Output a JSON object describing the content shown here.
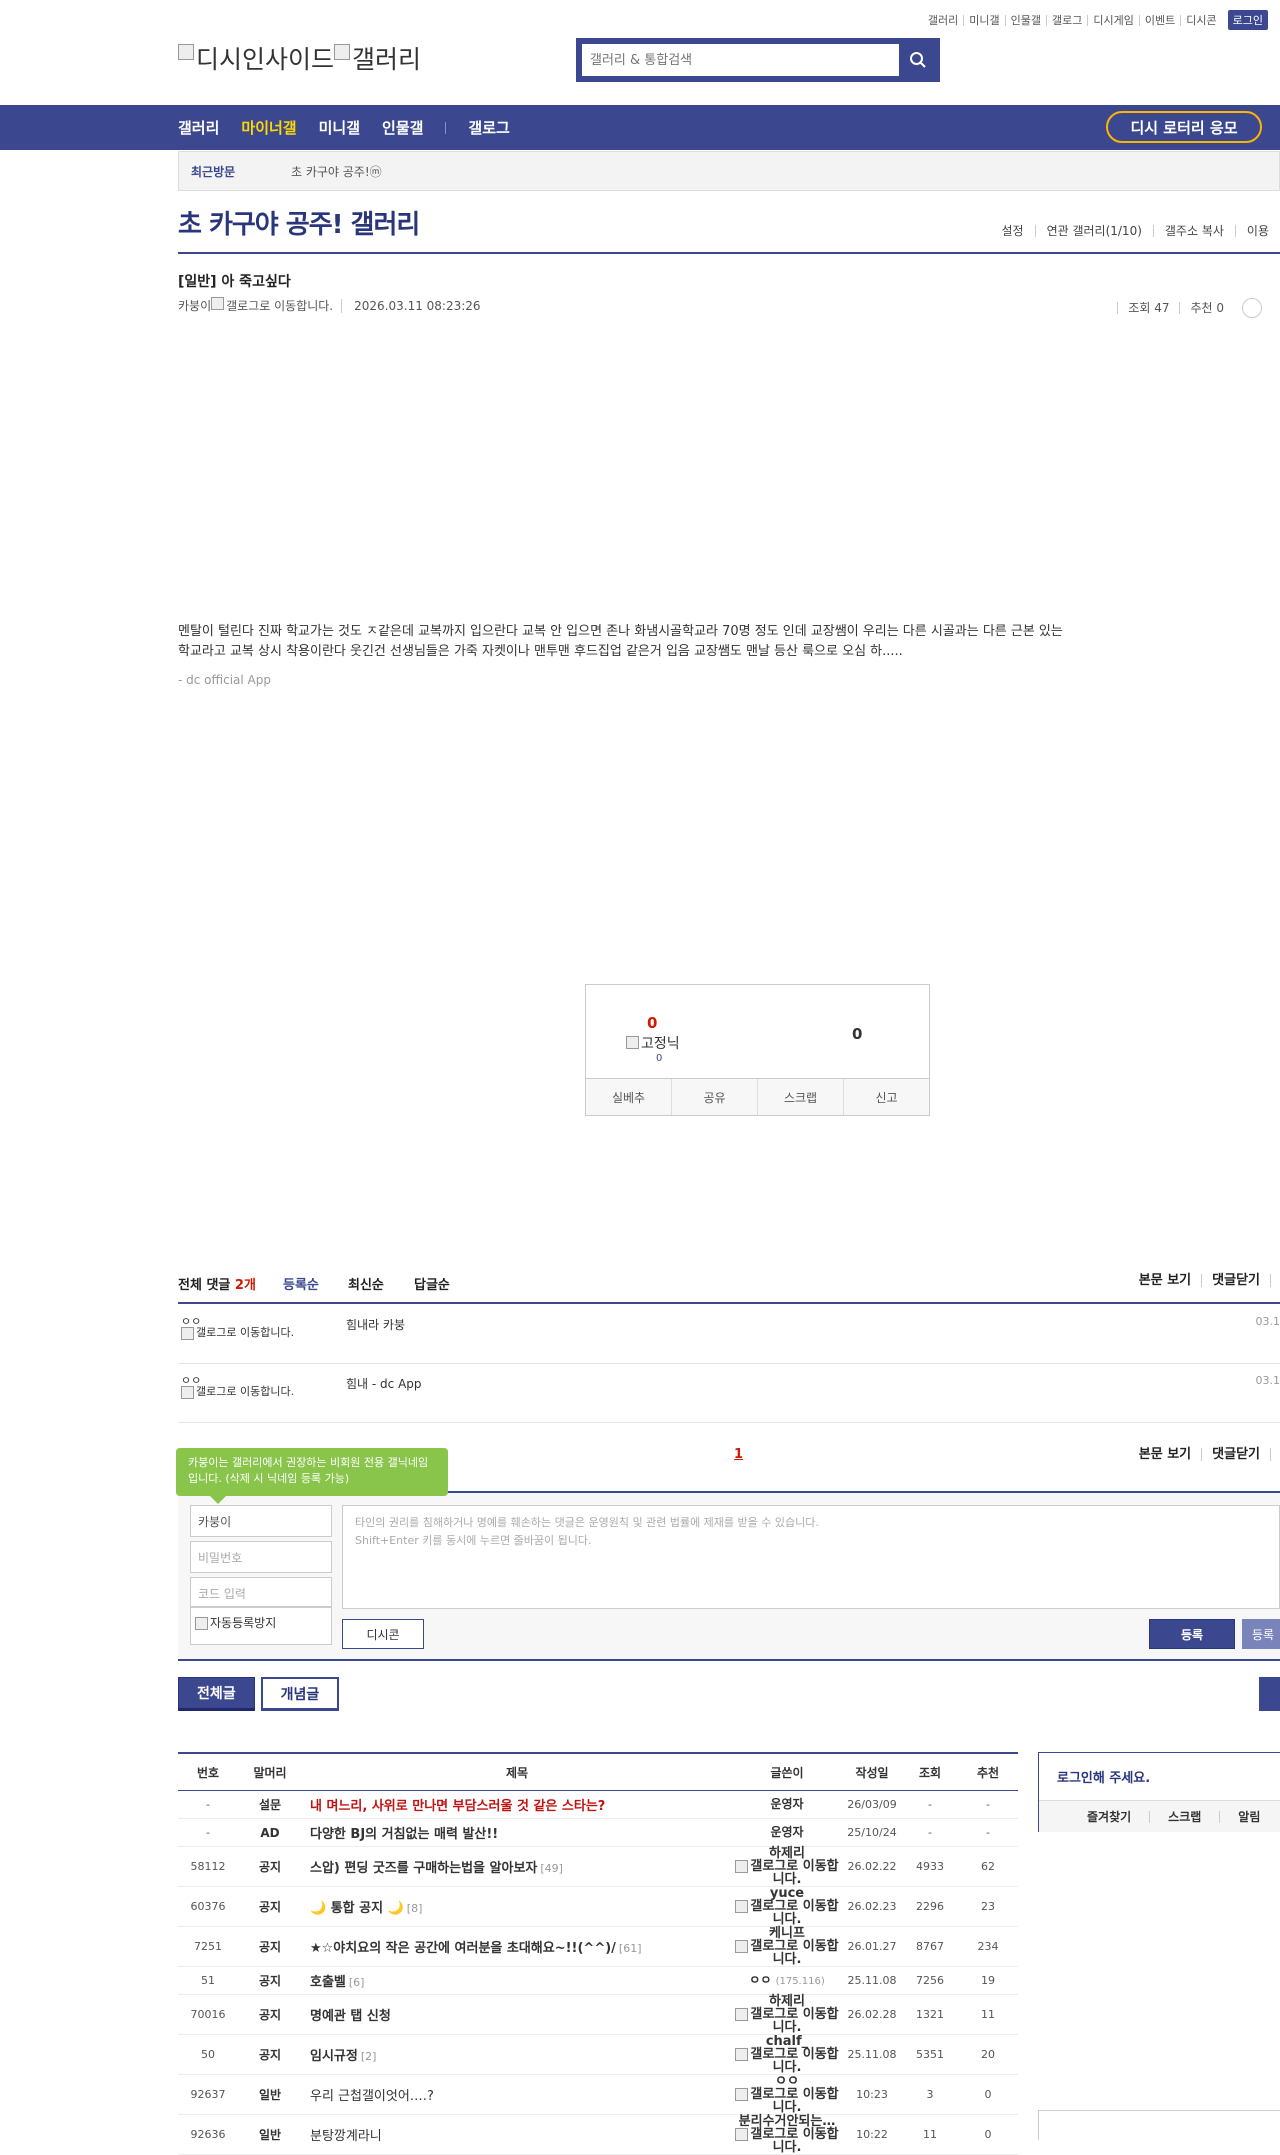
{
  "top_links": [
    "갤러리",
    "미니갤",
    "인물갤",
    "갤로그",
    "디시게임",
    "이벤트",
    "디시콘"
  ],
  "login_label": "로그인",
  "logo_text": "디시인사이드",
  "logo_sub": "갤러리",
  "search": {
    "placeholder": "갤러리 & 통합검색",
    "icon": "search-icon"
  },
  "gnb": {
    "items": [
      "갤러리",
      "마이너갤",
      "미니갤",
      "인물갤",
      "갤로그"
    ],
    "active_index": 1,
    "lotto_label": "디시 로터리 응모"
  },
  "recent": {
    "label": "최근방문",
    "item": "초 카구야 공주!ⓜ"
  },
  "gallery": {
    "title": "초 카구야 공주! 갤러리",
    "tools": [
      "설정",
      "연관 갤러리(1/10)",
      "갤주소 복사",
      "이용"
    ]
  },
  "post": {
    "title": "[일반] 아 죽고싶다",
    "writer": "카붕이",
    "gallog_alt": "갤로그로 이동합니다.",
    "date": "2026.03.11 08:23:26",
    "views": "조회 47",
    "recommend": "추천 0",
    "body": "멘탈이 털린다 진짜 학교가는 것도 ㅈ같은데 교복까지 입으란다 교복 안 입으면 존나 화냄시골학교라 70명 정도 인데 교장쌤이 우리는 다른 시골과는 다른 근본 있는 학교라고 교복 상시 착용이란다 웃긴건 선생님들은 가죽 자켓이나 맨투맨 후드집업 같은거 입음 교장쌤도 맨날 등산 룩으로 오심 하.....",
    "sign": "- dc official App"
  },
  "reco": {
    "up": "0",
    "fix_nick": "고정닉",
    "up_fix": "0",
    "down": "0",
    "buttons": [
      "실베추",
      "공유",
      "스크랩",
      "신고"
    ]
  },
  "comments": {
    "total_label": "전체 댓글",
    "count": "2개",
    "sorts": [
      "등록순",
      "최신순",
      "답글순"
    ],
    "right": [
      "본문 보기",
      "댓글닫기"
    ],
    "items": [
      {
        "nick": "ㅇㅇ",
        "gallog": "갤로그로 이동합니다.",
        "text": "힘내라 카붕",
        "date": "03.1"
      },
      {
        "nick": "ㅇㅇ",
        "gallog": "갤로그로 이동합니다.",
        "text": "힘내 - dc App",
        "date": "03.1"
      }
    ],
    "page": "1"
  },
  "write": {
    "tooltip": "카붕이는 갤러리에서 권장하는 비회원 전용 갤닉네임입니다. (삭제 시 닉네임 등록 가능)",
    "nick": "카붕이",
    "pw_placeholder": "비밀번호",
    "code_placeholder": "코드 입력",
    "captcha_alt": "자동등록방지",
    "textarea_line1": "타인의 권리를 침해하거나 명예를 훼손하는 댓글은 운영원칙 및 관련 법률에 제재를 받을 수 있습니다.",
    "textarea_line2": "Shift+Enter 키를 동시에 누르면 줄바꿈이 됩니다.",
    "dccon": "디시콘",
    "submit": "등록",
    "submit2": "등록"
  },
  "list_tabs": [
    "전체글",
    "개념글"
  ],
  "table": {
    "headers": [
      "번호",
      "말머리",
      "제목",
      "글쓴이",
      "작성일",
      "조회",
      "추천"
    ],
    "rows": [
      {
        "no": "-",
        "head": "설문",
        "subject": "내 며느리, 사위로 만나면 부담스러울 것 같은 스타는?",
        "rc": "",
        "writer": "운영자",
        "gallog": "",
        "ip": "",
        "date": "26/03/09",
        "views": "-",
        "rec": "-",
        "style": "red"
      },
      {
        "no": "-",
        "head": "AD",
        "subject": "다양한 BJ의 거침없는 매력 발산!!",
        "rc": "",
        "writer": "운영자",
        "gallog": "",
        "ip": "",
        "date": "25/10/24",
        "views": "-",
        "rec": "-",
        "style": "bold"
      },
      {
        "no": "58112",
        "head": "공지",
        "subject": "스압) 편딩 굿즈를 구매하는법을 알아보자",
        "rc": "[49]",
        "writer": "하제리",
        "gallog": "갤로그로 이동합니다.",
        "ip": "",
        "date": "26.02.22",
        "views": "4933",
        "rec": "62",
        "style": "bold"
      },
      {
        "no": "60376",
        "head": "공지",
        "subject": "🌙 통합 공지 🌙",
        "rc": "[8]",
        "writer": "yuce",
        "gallog": "갤로그로 이동합니다.",
        "ip": "",
        "date": "26.02.23",
        "views": "2296",
        "rec": "23",
        "style": "bold"
      },
      {
        "no": "7251",
        "head": "공지",
        "subject": "★☆야치요의 작은 공간에 여러분을 초대해요~!!(^^)/",
        "rc": "[61]",
        "writer": "케니프",
        "gallog": "갤로그로 이동합니다.",
        "ip": "",
        "date": "26.01.27",
        "views": "8767",
        "rec": "234",
        "style": "bold"
      },
      {
        "no": "51",
        "head": "공지",
        "subject": "호출벨",
        "rc": "[6]",
        "writer": "ㅇㅇ",
        "gallog": "",
        "ip": "(175.116)",
        "date": "25.11.08",
        "views": "7256",
        "rec": "19",
        "style": "bold"
      },
      {
        "no": "70016",
        "head": "공지",
        "subject": "명예관 탭 신청",
        "rc": "",
        "writer": "하제리",
        "gallog": "갤로그로 이동합니다.",
        "ip": "",
        "date": "26.02.28",
        "views": "1321",
        "rec": "11",
        "style": "bold"
      },
      {
        "no": "50",
        "head": "공지",
        "subject": "임시규정",
        "rc": "[2]",
        "writer": "chalf_",
        "gallog": "갤로그로 이동합니다.",
        "ip": "",
        "date": "25.11.08",
        "views": "5351",
        "rec": "20",
        "style": "bold"
      },
      {
        "no": "92637",
        "head": "일반",
        "subject": "우리 근첩갤이엇어….?",
        "rc": "",
        "writer": "ㅇㅇ",
        "gallog": "갤로그로 이동합니다.",
        "ip": "",
        "date": "10:23",
        "views": "3",
        "rec": "0",
        "style": "normal"
      },
      {
        "no": "92636",
        "head": "일반",
        "subject": "분탕깡계라니",
        "rc": "",
        "writer": "분리수거안되는…",
        "gallog": "갤로그로 이동합니다.",
        "ip": "",
        "date": "10:22",
        "views": "11",
        "rec": "0",
        "style": "normal"
      }
    ]
  },
  "loginbox": {
    "title": "로그인해 주세요.",
    "links": [
      "즐겨찾기",
      "스크랩",
      "알림"
    ]
  },
  "colors": {
    "brand": "#3b4890",
    "accent_yellow": "#ffd800",
    "red": "#d31900",
    "tooltip_green": "#89c44b"
  }
}
